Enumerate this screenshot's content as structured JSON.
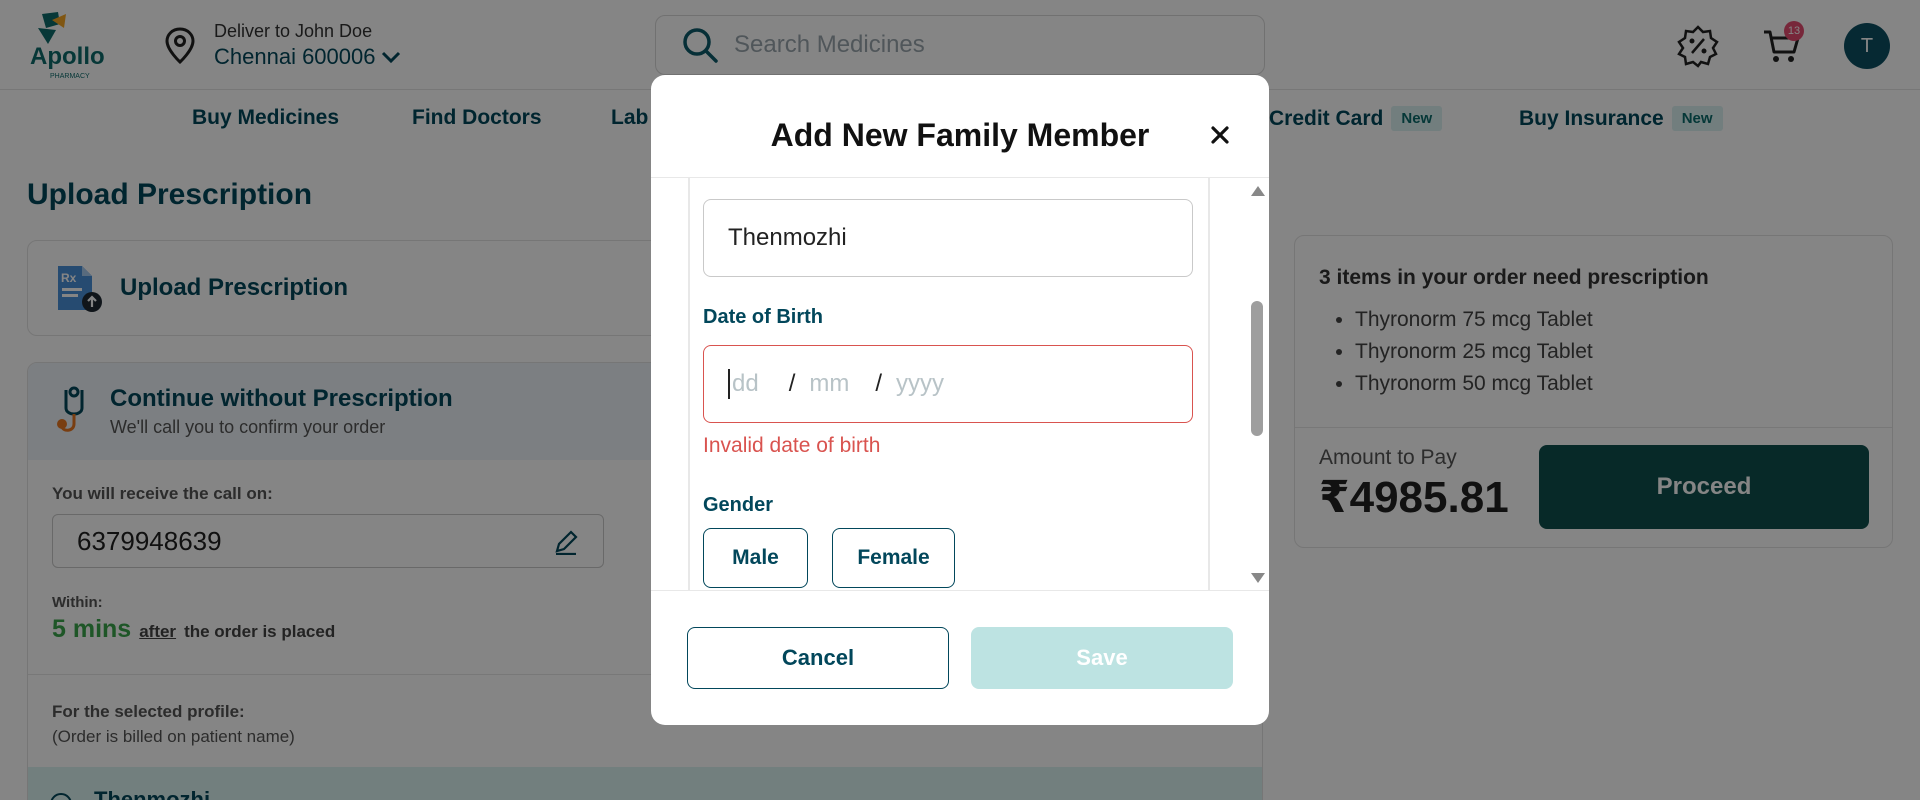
{
  "header": {
    "logo_text": "Apollo",
    "logo_sub": "PHARMACY",
    "deliver_to": "Deliver to John Doe",
    "city": "Chennai 600006",
    "search_placeholder": "Search Medicines",
    "cart_count": "13",
    "avatar_initial": "T"
  },
  "nav": {
    "items": [
      {
        "label": "Buy Medicines",
        "new": ""
      },
      {
        "label": "Find Doctors",
        "new": ""
      },
      {
        "label": "Lab",
        "new": ""
      },
      {
        "label": "Credit Card",
        "new": "New"
      },
      {
        "label": "Buy Insurance",
        "new": "New"
      }
    ]
  },
  "page": {
    "title": "Upload Prescription",
    "upload_label": "Upload Prescription",
    "continue_title": "Continue without Prescription",
    "continue_sub": "We'll call you to confirm your order",
    "call_label": "You will receive the call on:",
    "phone": "6379948639",
    "within_label": "Within:",
    "mins": "5 mins",
    "after": "after",
    "placed": "the order is placed",
    "profile_label": "For the selected profile:",
    "profile_sub": "(Order is billed on patient name)",
    "profile_name": "Thenmozhi"
  },
  "summary": {
    "title": "3 items in your order need prescription",
    "items": [
      "Thyronorm 75 mcg Tablet",
      "Thyronorm 25 mcg Tablet",
      "Thyronorm 50 mcg Tablet"
    ],
    "amount_label": "Amount to Pay",
    "amount": "₹4985.81",
    "proceed": "Proceed"
  },
  "modal": {
    "title": "Add New Family Member",
    "name_value": "Thenmozhi",
    "dob_label": "Date of Birth",
    "dob_dd": "dd",
    "dob_mm": "mm",
    "dob_yyyy": "yyyy",
    "dob_sep": "/",
    "dob_error": "Invalid date of birth",
    "gender_label": "Gender",
    "gender_options": [
      "Male",
      "Female"
    ],
    "cancel": "Cancel",
    "save": "Save"
  },
  "colors": {
    "brand": "#02475b",
    "proceed": "#0e4f4d",
    "error": "#d9534f",
    "success": "#3aa64c",
    "save_disabled": "#bde3e2"
  }
}
